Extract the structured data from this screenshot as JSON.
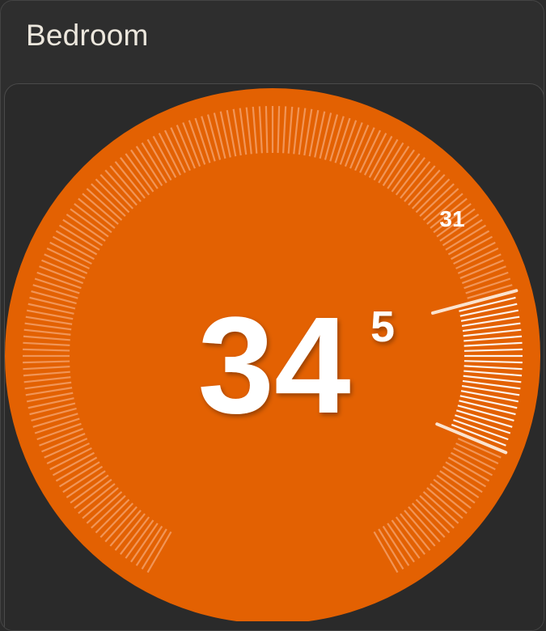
{
  "card": {
    "title": "Bedroom"
  },
  "thermostat": {
    "current_temp_whole": "34",
    "current_temp_fraction": "5",
    "target_temp": "31",
    "target_value": 31,
    "current_value": 34.5,
    "min_value": 10,
    "max_value": 38,
    "mode": "heat"
  },
  "colors": {
    "dial_heat": "#e36102",
    "background": "#2b2b2b",
    "tick_dim": "#f6a774",
    "tick_active": "#ffffff",
    "title_text": "#ece7dd"
  }
}
